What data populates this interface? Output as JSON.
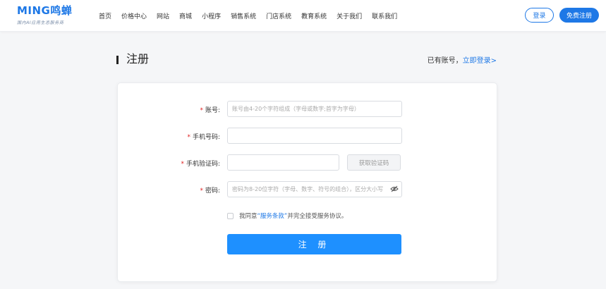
{
  "header": {
    "logo_main": "MING鸣蝉",
    "logo_sub": "国内AI应用生态服务商",
    "nav": [
      "首页",
      "价格中心",
      "网站",
      "商城",
      "小程序",
      "销售系统",
      "门店系统",
      "教育系统",
      "关于我们",
      "联系我们"
    ],
    "login_button": "登录",
    "register_button": "免费注册"
  },
  "page": {
    "title": "注册",
    "has_account_text": "已有账号，",
    "login_link": "立即登录>"
  },
  "form": {
    "account_label": "账号:",
    "account_placeholder": "账号由4-20个字符组成（字母或数字;首字为字母）",
    "phone_label": "手机号码:",
    "phone_placeholder": "",
    "code_label": "手机验证码:",
    "code_placeholder": "",
    "get_code_button": "获取验证码",
    "password_label": "密码:",
    "password_placeholder": "密码为8-20位字符（字母、数字、符号的组合），区分大小写",
    "agree_prefix": "我同意",
    "agree_terms": "“服务条款”",
    "agree_suffix": "并完全接受服务协议。",
    "submit_button": "注 册",
    "required_mark": "*"
  },
  "colors": {
    "brand": "#1e78e6",
    "submit": "#1e90ff",
    "required": "#e02020"
  },
  "icons": {
    "password_toggle": "eye-off-icon"
  }
}
